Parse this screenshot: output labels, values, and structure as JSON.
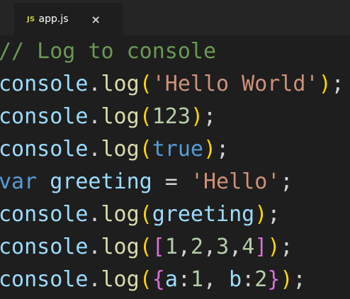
{
  "tabs": [
    {
      "icon": "JS",
      "label": "app.js",
      "close": "×"
    }
  ],
  "editor": {
    "lines": [
      [
        {
          "t": "// Log to console",
          "c": "t-cmt"
        }
      ],
      [
        {
          "t": "console",
          "c": "t-id"
        },
        {
          "t": ".",
          "c": "t-p"
        },
        {
          "t": "log",
          "c": "t-fn"
        },
        {
          "t": "(",
          "c": "t-b1"
        },
        {
          "t": "'Hello World'",
          "c": "t-str"
        },
        {
          "t": ")",
          "c": "t-b1"
        },
        {
          "t": ";",
          "c": "t-p"
        }
      ],
      [
        {
          "t": "console",
          "c": "t-id"
        },
        {
          "t": ".",
          "c": "t-p"
        },
        {
          "t": "log",
          "c": "t-fn"
        },
        {
          "t": "(",
          "c": "t-b1"
        },
        {
          "t": "123",
          "c": "t-num"
        },
        {
          "t": ")",
          "c": "t-b1"
        },
        {
          "t": ";",
          "c": "t-p"
        }
      ],
      [
        {
          "t": "console",
          "c": "t-id"
        },
        {
          "t": ".",
          "c": "t-p"
        },
        {
          "t": "log",
          "c": "t-fn"
        },
        {
          "t": "(",
          "c": "t-b1"
        },
        {
          "t": "true",
          "c": "t-kw"
        },
        {
          "t": ")",
          "c": "t-b1"
        },
        {
          "t": ";",
          "c": "t-p"
        }
      ],
      [
        {
          "t": "var",
          "c": "t-kw"
        },
        {
          "t": " ",
          "c": "t-p"
        },
        {
          "t": "greeting",
          "c": "t-id"
        },
        {
          "t": " = ",
          "c": "t-p"
        },
        {
          "t": "'Hello'",
          "c": "t-str"
        },
        {
          "t": ";",
          "c": "t-p"
        }
      ],
      [
        {
          "t": "console",
          "c": "t-id"
        },
        {
          "t": ".",
          "c": "t-p"
        },
        {
          "t": "log",
          "c": "t-fn"
        },
        {
          "t": "(",
          "c": "t-b1"
        },
        {
          "t": "greeting",
          "c": "t-id"
        },
        {
          "t": ")",
          "c": "t-b1"
        },
        {
          "t": ";",
          "c": "t-p"
        }
      ],
      [
        {
          "t": "console",
          "c": "t-id"
        },
        {
          "t": ".",
          "c": "t-p"
        },
        {
          "t": "log",
          "c": "t-fn"
        },
        {
          "t": "(",
          "c": "t-b1"
        },
        {
          "t": "[",
          "c": "t-b2"
        },
        {
          "t": "1",
          "c": "t-num"
        },
        {
          "t": ",",
          "c": "t-p"
        },
        {
          "t": "2",
          "c": "t-num"
        },
        {
          "t": ",",
          "c": "t-p"
        },
        {
          "t": "3",
          "c": "t-num"
        },
        {
          "t": ",",
          "c": "t-p"
        },
        {
          "t": "4",
          "c": "t-num"
        },
        {
          "t": "]",
          "c": "t-b2"
        },
        {
          "t": ")",
          "c": "t-b1"
        },
        {
          "t": ";",
          "c": "t-p"
        }
      ],
      [
        {
          "t": "console",
          "c": "t-id"
        },
        {
          "t": ".",
          "c": "t-p"
        },
        {
          "t": "log",
          "c": "t-fn"
        },
        {
          "t": "(",
          "c": "t-b1"
        },
        {
          "t": "{",
          "c": "t-b2"
        },
        {
          "t": "a",
          "c": "t-id"
        },
        {
          "t": ":",
          "c": "t-p"
        },
        {
          "t": "1",
          "c": "t-num"
        },
        {
          "t": ", ",
          "c": "t-p"
        },
        {
          "t": "b",
          "c": "t-id"
        },
        {
          "t": ":",
          "c": "t-p"
        },
        {
          "t": "2",
          "c": "t-num"
        },
        {
          "t": "}",
          "c": "t-b2"
        },
        {
          "t": ")",
          "c": "t-b1"
        },
        {
          "t": ";",
          "c": "t-p"
        }
      ]
    ]
  },
  "colors": {
    "background": "#1e1e1e",
    "tabbar": "#252526",
    "comment": "#6a9955",
    "identifier": "#9cdcfe",
    "function": "#dcdcaa",
    "string": "#ce9178",
    "number": "#b5cea8",
    "keyword": "#569cd6",
    "bracket_level1": "#ffd700",
    "bracket_level2": "#da70d6",
    "js_icon": "#cbcb41"
  }
}
